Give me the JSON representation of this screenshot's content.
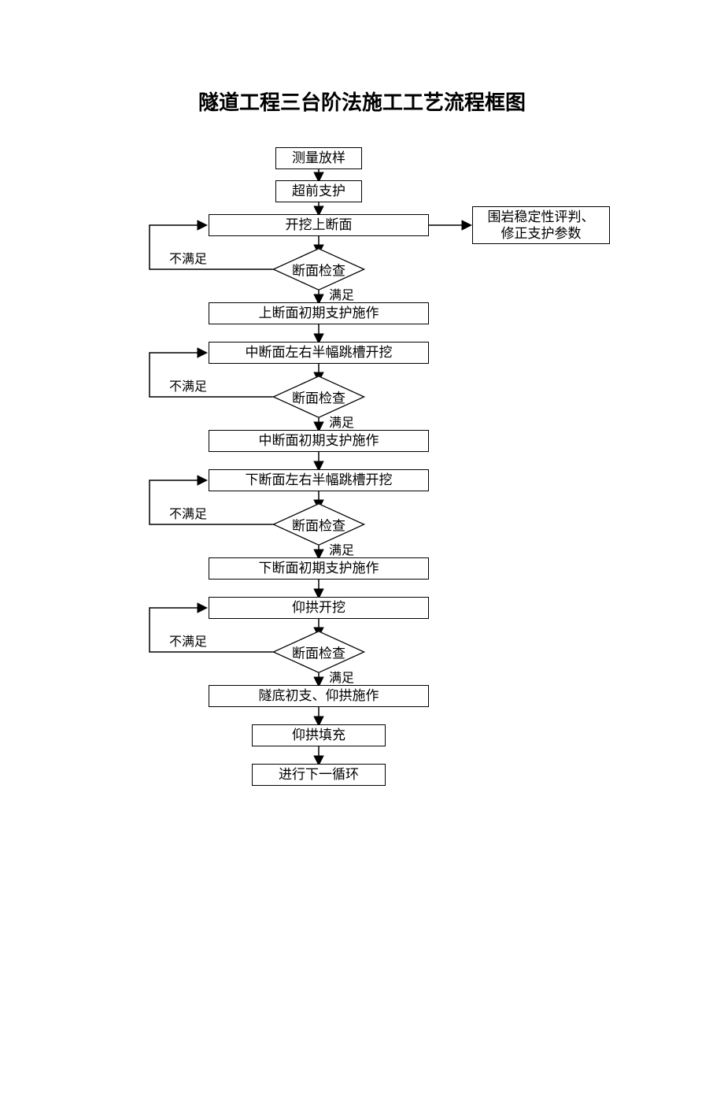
{
  "title": "隧道工程三台阶法施工工艺流程框图",
  "nodes": {
    "n1": "测量放样",
    "n2": "超前支护",
    "n3": "开挖上断面",
    "n4": "断面检查",
    "n5": "上断面初期支护施作",
    "n6": "中断面左右半幅跳槽开挖",
    "n7": "断面检查",
    "n8": "中断面初期支护施作",
    "n9": "下断面左右半幅跳槽开挖",
    "n10": "断面检查",
    "n11": "下断面初期支护施作",
    "n12": "仰拱开挖",
    "n13": "断面检查",
    "n14": "隧底初支、仰拱施作",
    "n15": "仰拱填充",
    "n16": "进行下一循环",
    "side": "围岩稳定性评判、\n修正支护参数"
  },
  "labels": {
    "pass": "满足",
    "fail": "不满足"
  }
}
